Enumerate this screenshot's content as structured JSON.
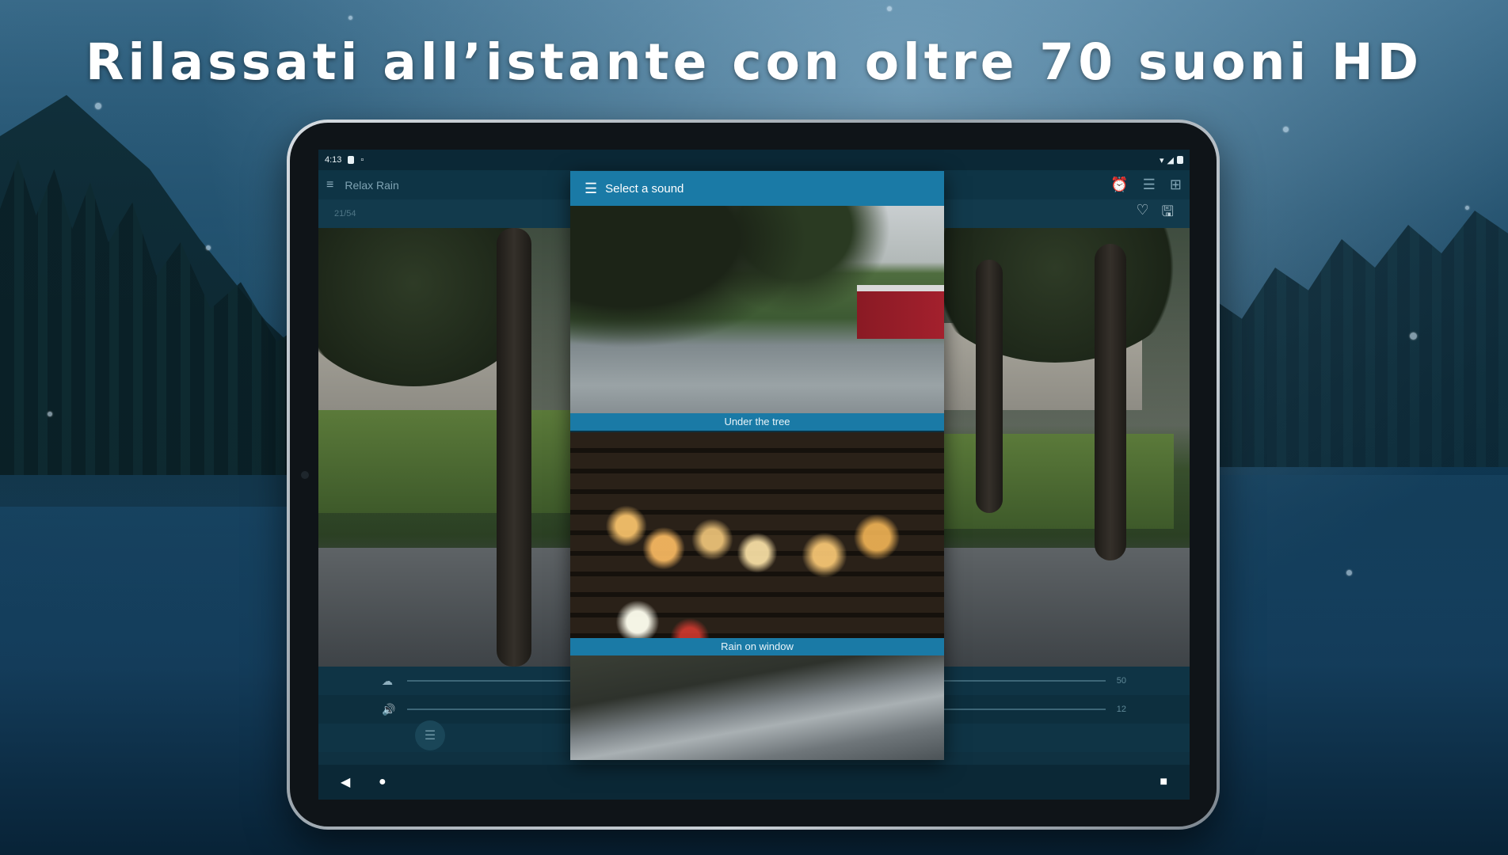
{
  "headline": "Rilassati all’istante con oltre 70 suoni HD",
  "status_bar": {
    "time": "4:13"
  },
  "app": {
    "title": "Relax Rain",
    "menu_icon": "hamburger-icon",
    "actions": [
      "alarm-icon",
      "playlist-icon",
      "add-widget-icon"
    ],
    "counter": "21/54",
    "sub_actions": [
      "heart-icon",
      "save-icon"
    ]
  },
  "controls": {
    "rain_value": "50",
    "volume_value": "12",
    "volume_level": 0.63
  },
  "dialog": {
    "title": "Select a sound",
    "items": [
      {
        "label": "Under the tree"
      },
      {
        "label": "Rain on window"
      },
      {
        "label": ""
      }
    ]
  },
  "navbar": [
    "back-icon",
    "home-icon",
    "recents-icon"
  ]
}
